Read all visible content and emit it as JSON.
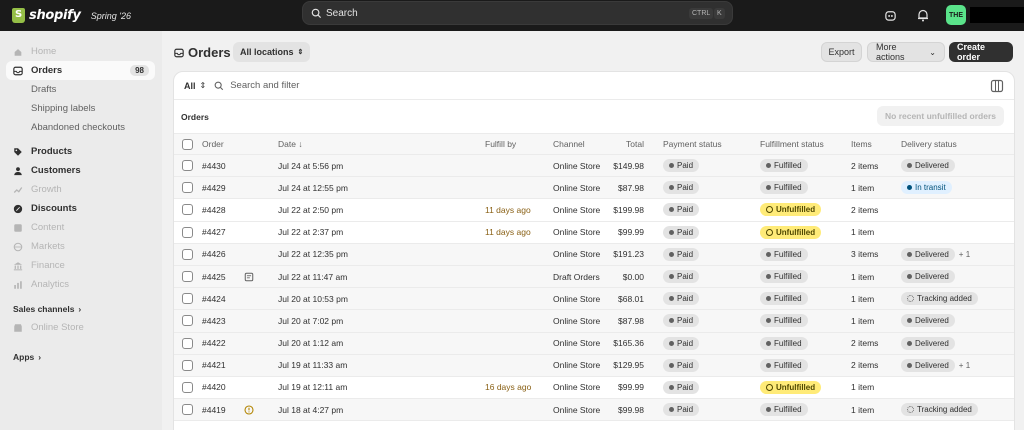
{
  "topbar": {
    "logo_text": "shopify",
    "edition": "Spring '26",
    "search_placeholder": "Search",
    "kbd_ctrl": "CTRL",
    "kbd_k": "K",
    "avatar_initials": "THE"
  },
  "sidebar": {
    "items": [
      {
        "label": "Home",
        "icon": "home-icon",
        "style": "dim"
      },
      {
        "label": "Orders",
        "icon": "inbox-icon",
        "style": "active",
        "count": "98"
      },
      {
        "label": "Drafts",
        "style": "sub"
      },
      {
        "label": "Shipping labels",
        "style": "sub"
      },
      {
        "label": "Abandoned checkouts",
        "style": "sub"
      },
      {
        "label": "Products",
        "icon": "tag-icon",
        "style": "bold"
      },
      {
        "label": "Customers",
        "icon": "person-icon",
        "style": "bold"
      },
      {
        "label": "Growth",
        "icon": "growth-icon",
        "style": "dim"
      },
      {
        "label": "Discounts",
        "icon": "discount-icon",
        "style": "bold"
      },
      {
        "label": "Content",
        "icon": "content-icon",
        "style": "dim"
      },
      {
        "label": "Markets",
        "icon": "globe-icon",
        "style": "dim"
      },
      {
        "label": "Finance",
        "icon": "bank-icon",
        "style": "dim"
      },
      {
        "label": "Analytics",
        "icon": "chart-icon",
        "style": "dim"
      }
    ],
    "sales_channels_label": "Sales channels",
    "online_store_label": "Online Store",
    "apps_label": "Apps"
  },
  "page": {
    "title": "Orders",
    "location_filter": "All locations",
    "export_label": "Export",
    "more_actions_label": "More actions",
    "create_label": "Create order"
  },
  "filter": {
    "tab_all": "All",
    "search_placeholder": "Search and filter"
  },
  "orders_section": {
    "label": "Orders",
    "ghost_button": "No recent unfulfilled orders"
  },
  "table": {
    "headers": {
      "order": "Order",
      "date": "Date ↓",
      "fulfill_by": "Fulfill by",
      "channel": "Channel",
      "total": "Total",
      "payment": "Payment status",
      "fulfillment": "Fulfillment status",
      "items": "Items",
      "delivery": "Delivery status"
    },
    "rows": [
      {
        "order": "#4430",
        "date": "Jul 24 at 5:56 pm",
        "fulfill_by": "",
        "channel": "Online Store",
        "total": "$149.98",
        "payment": "Paid",
        "fulfillment": "Fulfilled",
        "items": "2 items",
        "delivery": "Delivered",
        "extra": "",
        "note": ""
      },
      {
        "order": "#4429",
        "date": "Jul 24 at 12:55 pm",
        "fulfill_by": "",
        "channel": "Online Store",
        "total": "$87.98",
        "payment": "Paid",
        "fulfillment": "Fulfilled",
        "items": "1 item",
        "delivery": "In transit",
        "extra": "",
        "note": ""
      },
      {
        "order": "#4428",
        "date": "Jul 22 at 2:50 pm",
        "fulfill_by": "11 days ago",
        "channel": "Online Store",
        "total": "$199.98",
        "payment": "Paid",
        "fulfillment": "Unfulfilled",
        "items": "2 items",
        "delivery": "",
        "extra": "",
        "note": ""
      },
      {
        "order": "#4427",
        "date": "Jul 22 at 2:37 pm",
        "fulfill_by": "11 days ago",
        "channel": "Online Store",
        "total": "$99.99",
        "payment": "Paid",
        "fulfillment": "Unfulfilled",
        "items": "1 item",
        "delivery": "",
        "extra": "",
        "note": ""
      },
      {
        "order": "#4426",
        "date": "Jul 22 at 12:35 pm",
        "fulfill_by": "",
        "channel": "Online Store",
        "total": "$191.23",
        "payment": "Paid",
        "fulfillment": "Fulfilled",
        "items": "3 items",
        "delivery": "Delivered",
        "extra": "+ 1",
        "note": ""
      },
      {
        "order": "#4425",
        "date": "Jul 22 at 11:47 am",
        "fulfill_by": "",
        "channel": "Draft Orders",
        "total": "$0.00",
        "payment": "Paid",
        "fulfillment": "Fulfilled",
        "items": "1 item",
        "delivery": "Delivered",
        "extra": "",
        "note": "note-icon"
      },
      {
        "order": "#4424",
        "date": "Jul 20 at 10:53 pm",
        "fulfill_by": "",
        "channel": "Online Store",
        "total": "$68.01",
        "payment": "Paid",
        "fulfillment": "Fulfilled",
        "items": "1 item",
        "delivery": "Tracking added",
        "extra": "",
        "note": ""
      },
      {
        "order": "#4423",
        "date": "Jul 20 at 7:02 pm",
        "fulfill_by": "",
        "channel": "Online Store",
        "total": "$87.98",
        "payment": "Paid",
        "fulfillment": "Fulfilled",
        "items": "1 item",
        "delivery": "Delivered",
        "extra": "",
        "note": ""
      },
      {
        "order": "#4422",
        "date": "Jul 20 at 1:12 am",
        "fulfill_by": "",
        "channel": "Online Store",
        "total": "$165.36",
        "payment": "Paid",
        "fulfillment": "Fulfilled",
        "items": "2 items",
        "delivery": "Delivered",
        "extra": "",
        "note": ""
      },
      {
        "order": "#4421",
        "date": "Jul 19 at 11:33 am",
        "fulfill_by": "",
        "channel": "Online Store",
        "total": "$129.95",
        "payment": "Paid",
        "fulfillment": "Fulfilled",
        "items": "2 items",
        "delivery": "Delivered",
        "extra": "+ 1",
        "note": ""
      },
      {
        "order": "#4420",
        "date": "Jul 19 at 12:11 am",
        "fulfill_by": "16 days ago",
        "channel": "Online Store",
        "total": "$99.99",
        "payment": "Paid",
        "fulfillment": "Unfulfilled",
        "items": "1 item",
        "delivery": "",
        "extra": "",
        "note": ""
      },
      {
        "order": "#4419",
        "date": "Jul 18 at 4:27 pm",
        "fulfill_by": "",
        "channel": "Online Store",
        "total": "$99.98",
        "payment": "Paid",
        "fulfillment": "Fulfilled",
        "items": "1 item",
        "delivery": "Tracking added",
        "extra": "",
        "note": "alert-icon"
      }
    ]
  },
  "colors": {
    "topbar": "#1a1a1a",
    "unfulfilled_badge": "#ffeb78",
    "in_transit_badge": "#e0f0ff",
    "primary_button": "#303030",
    "avatar": "#5ae38a"
  }
}
